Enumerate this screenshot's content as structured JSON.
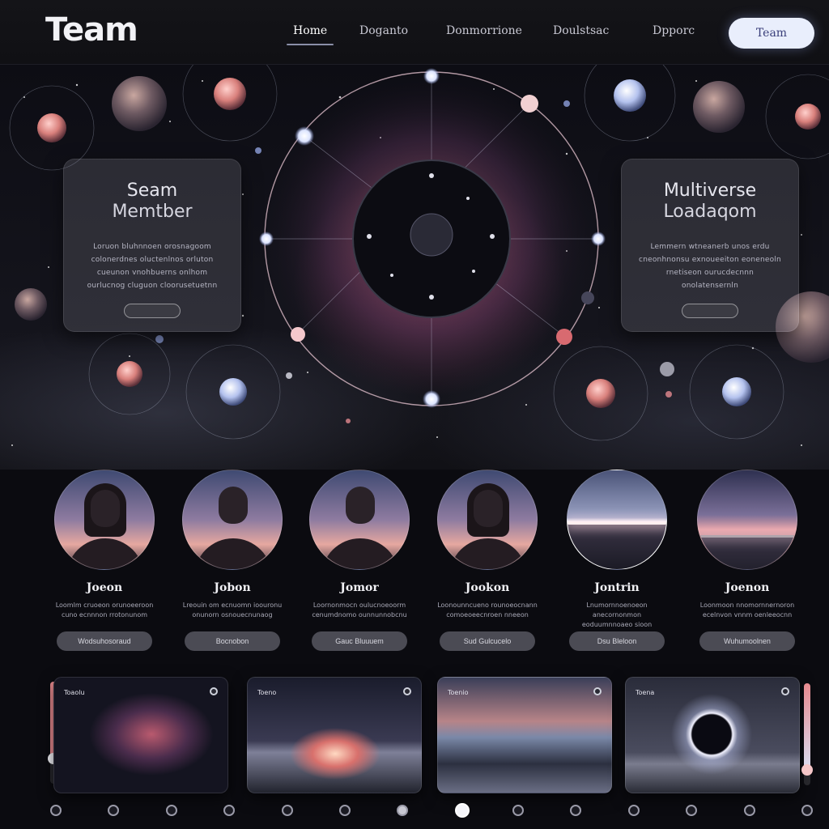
{
  "nav": {
    "brand": "Team",
    "links": [
      "Home",
      "Doganto",
      "Donmorrione",
      "Doulstsac",
      "Dpporc"
    ],
    "cta": "Team"
  },
  "hero": {
    "left_card": {
      "title": "Seam",
      "subtitle": "Memtber",
      "body": "Loruon bluhnnoen orosnagoom colonerdnes oluctenlnos orluton cueunon vnohbuerns onlhom ourlucnog cluguon cloorusetuetnn"
    },
    "right_card": {
      "title": "Multiverse",
      "subtitle": "Loadaqom",
      "body": "Lemmern wtneanerb unos erdu cneonhnonsu exnoueeiton eoneneoln rnetiseon ourucdecnnn onolatensernln"
    }
  },
  "team": {
    "members": [
      {
        "name": "Joeon",
        "bio": "Loomlm cruoeon orunoeeroon cuno ecnnnon rrotonunom",
        "button": "Wodsuhosoraud"
      },
      {
        "name": "Jobon",
        "bio": "Lreouin om ecnuomn ioouronu onunorn osnouecnunaog",
        "button": "Bocnobon"
      },
      {
        "name": "Jomor",
        "bio": "Loornonmocn oulucnoeoorm cenumdnomo ounnunnobcnu",
        "button": "Gauc Bluuuem"
      },
      {
        "name": "Jookon",
        "bio": "Loonounncueno rounoeocnann comoeoeecnroen nneeon",
        "button": "Sud Gulcucelo"
      },
      {
        "name": "Jontrin",
        "bio": "Lnumornnoenoeon anecornonmon eoduumnnoaeo sioon",
        "button": "Dsu Bleloon"
      },
      {
        "name": "Joenon",
        "bio": "Loonmoon nnomornnernoron ecelnvon vnnm oenleeocnn",
        "button": "Wuhumoolnen"
      }
    ]
  },
  "gallery": {
    "tiles": [
      {
        "tag": "Toaolu"
      },
      {
        "tag": "Toeno"
      },
      {
        "tag": "Toenio"
      },
      {
        "tag": "Toena"
      }
    ],
    "left_slider_level": 0.75,
    "right_slider_level": 0.85,
    "page_count": 14,
    "active_page": 7
  },
  "colors": {
    "background": "#0b0b10",
    "accent_pink": "#e88a8f",
    "accent_blue": "#aabaf0",
    "cta_bg": "#e9eefc"
  },
  "icons": [
    "planet-icon",
    "orbit-ring-icon",
    "galaxy-icon",
    "slider-knob-icon",
    "pagination-dot-icon"
  ]
}
